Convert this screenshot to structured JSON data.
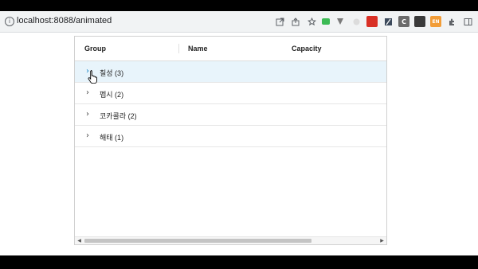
{
  "browser": {
    "url": "localhost:8088/animated",
    "info_glyph": "i",
    "icons": [
      "open-external-icon",
      "share-icon",
      "star-icon",
      "extension-green-icon",
      "extension-v-icon",
      "extension-gray-icon",
      "extension-red-icon",
      "extension-slash-icon",
      "extension-c-icon",
      "extension-dark-icon",
      "extension-orange-icon",
      "extensions-puzzle-icon",
      "sidebar-icon"
    ],
    "ext_c_label": "C",
    "ext_orange_label": "EN"
  },
  "grid": {
    "columns": [
      "Group",
      "Name",
      "Capacity"
    ],
    "rows": [
      {
        "label": "칠성 (3)",
        "active": true
      },
      {
        "label": "펩시 (2)",
        "active": false
      },
      {
        "label": "코카콜라 (2)",
        "active": false
      },
      {
        "label": "해태 (1)",
        "active": false
      }
    ],
    "expand_glyph": "›",
    "scroll_left": "◀",
    "scroll_right": "▶"
  },
  "colors": {
    "active_row_bg": "#e8f4fb",
    "accent": "#1e88c8"
  }
}
